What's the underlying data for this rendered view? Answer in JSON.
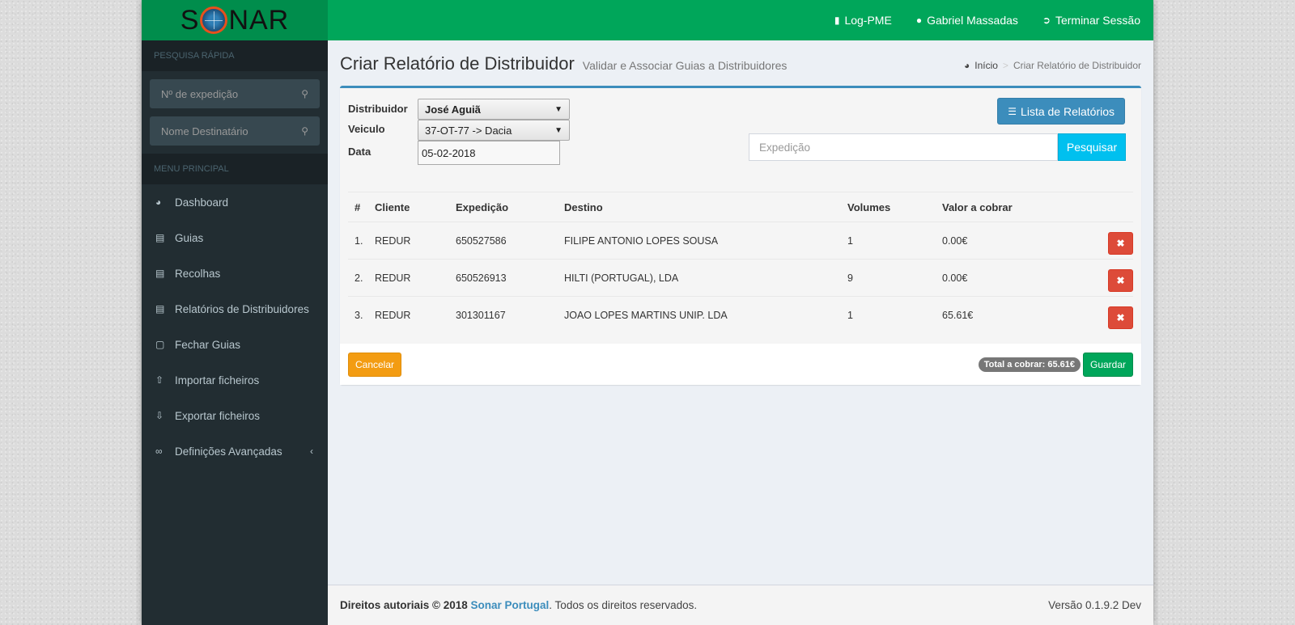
{
  "brand": {
    "logo_text_pre": "S",
    "logo_text_post": "NAR"
  },
  "navbar": {
    "items": [
      {
        "icon": "bookmark-icon",
        "label": "Log-PME"
      },
      {
        "icon": "user-icon",
        "label": "Gabriel Massadas"
      },
      {
        "icon": "sign-out-icon",
        "label": "Terminar Sessão"
      }
    ]
  },
  "sidebar": {
    "quick_search_header": "PESQUISA RÁPIDA",
    "search1_placeholder": "Nº de expedição",
    "search2_placeholder": "Nome Destinatário",
    "menu_header": "MENU PRINCIPAL",
    "items": [
      {
        "icon": "dashboard-icon",
        "label": "Dashboard"
      },
      {
        "icon": "file-icon",
        "label": "Guias"
      },
      {
        "icon": "file-icon",
        "label": "Recolhas"
      },
      {
        "icon": "list-alt-icon",
        "label": "Relatórios de Distribuidores"
      },
      {
        "icon": "file-outline-icon",
        "label": "Fechar Guias"
      },
      {
        "icon": "upload-icon",
        "label": "Importar ficheiros"
      },
      {
        "icon": "download-icon",
        "label": "Exportar ficheiros"
      },
      {
        "icon": "link-icon",
        "label": "Definições Avançadas"
      }
    ]
  },
  "page": {
    "title": "Criar Relatório de Distribuidor",
    "subtitle": "Validar e Associar Guias a Distribuidores",
    "breadcrumb_home": "Início",
    "breadcrumb_current": "Criar Relatório de Distribuidor"
  },
  "form": {
    "distribuidor_label": "Distribuidor",
    "distribuidor_value": "José Aguiã",
    "veiculo_label": "Veiculo",
    "veiculo_value": "37-OT-77 -> Dacia",
    "data_label": "Data",
    "data_value": "05-02-2018",
    "lista_button": "Lista de Relatórios",
    "search_placeholder": "Expedição",
    "search_button": "Pesquisar"
  },
  "table": {
    "headers": [
      "#",
      "Cliente",
      "Expedição",
      "Destino",
      "Volumes",
      "Valor a cobrar"
    ],
    "rows": [
      {
        "n": "1.",
        "cliente": "REDUR",
        "expedicao": "650527586",
        "destino": "FILIPE ANTONIO LOPES SOUSA",
        "volumes": "1",
        "valor": "0.00€"
      },
      {
        "n": "2.",
        "cliente": "REDUR",
        "expedicao": "650526913",
        "destino": "HILTI (PORTUGAL), LDA",
        "volumes": "9",
        "valor": "0.00€"
      },
      {
        "n": "3.",
        "cliente": "REDUR",
        "expedicao": "301301167",
        "destino": "JOAO LOPES MARTINS UNIP. LDA",
        "volumes": "1",
        "valor": "65.61€"
      }
    ]
  },
  "actions": {
    "cancel": "Cancelar",
    "total": "Total a cobrar: 65.61€",
    "save": "Guardar"
  },
  "footer": {
    "copyright": "Direitos autoriais © 2018",
    "company": "Sonar Portugal",
    "rights": ". Todos os direitos reservados.",
    "version": "Versão 0.1.9.2 Dev"
  },
  "colors": {
    "header_green": "#00a65a",
    "logo_green": "#008d4c",
    "sidebar_dark": "#222d32",
    "primary_blue": "#3c8dbc",
    "danger_red": "#dd4b39",
    "warning_orange": "#f39c12",
    "info_cyan": "#00c0ef"
  }
}
